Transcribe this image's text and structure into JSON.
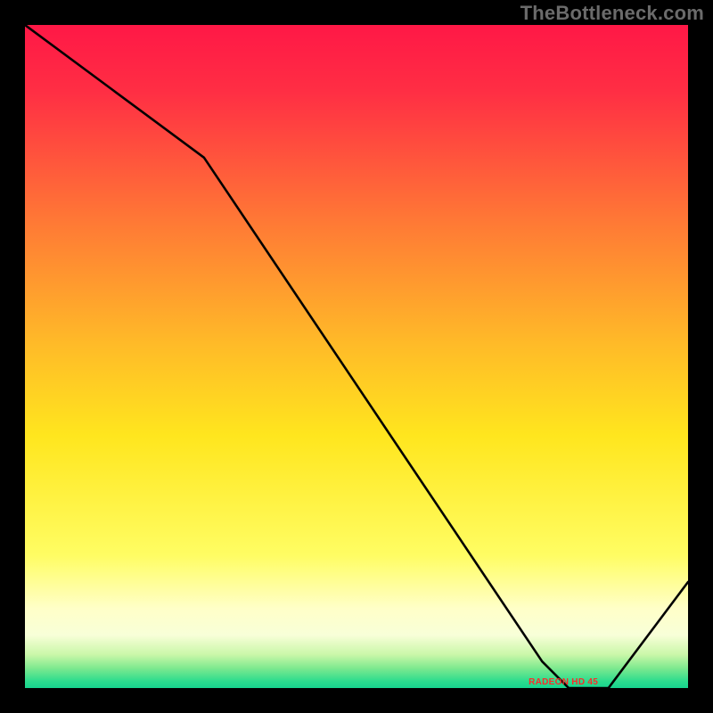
{
  "watermark": "TheBottleneck.com",
  "annotation_text": "RADEON HD 45",
  "chart_data": {
    "type": "line",
    "title": "",
    "xlabel": "",
    "ylabel": "",
    "xlim": [
      0,
      100
    ],
    "ylim": [
      0,
      100
    ],
    "x": [
      0,
      27,
      78,
      82,
      88,
      100
    ],
    "values": [
      100,
      80,
      4,
      0,
      0,
      16
    ],
    "background": "rainbow-vertical",
    "line_color": "#000000",
    "annotation": {
      "text": "RADEON HD 45",
      "x": 82,
      "y": 0
    }
  }
}
